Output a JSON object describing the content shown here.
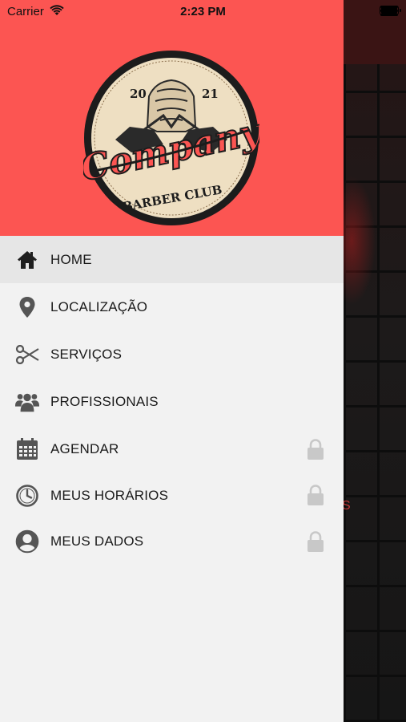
{
  "status_bar": {
    "carrier": "Carrier",
    "time": "2:23 PM"
  },
  "logo": {
    "year_left": "20",
    "year_right": "21",
    "brand": "Company",
    "subtitle": "BARBER CLUB"
  },
  "colors": {
    "header": "#fc5552",
    "drawer_bg": "#f2f2f2",
    "active_row": "#e6e6e6",
    "icon": "#3a3a3a",
    "lock": "#c8c8c8"
  },
  "menu": {
    "items": [
      {
        "label": "HOME",
        "icon": "home-icon",
        "locked": false,
        "active": true
      },
      {
        "label": "LOCALIZAÇÃO",
        "icon": "location-pin-icon",
        "locked": false,
        "active": false
      },
      {
        "label": "SERVIÇOS",
        "icon": "scissors-icon",
        "locked": false,
        "active": false
      },
      {
        "label": "PROFISSIONAIS",
        "icon": "users-icon",
        "locked": false,
        "active": false
      },
      {
        "label": "AGENDAR",
        "icon": "calendar-icon",
        "locked": true,
        "active": false
      },
      {
        "label": "MEUS HORÁRIOS",
        "icon": "clock-icon",
        "locked": true,
        "active": false
      },
      {
        "label": "MEUS DADOS",
        "icon": "user-circle-icon",
        "locked": true,
        "active": false
      }
    ]
  }
}
